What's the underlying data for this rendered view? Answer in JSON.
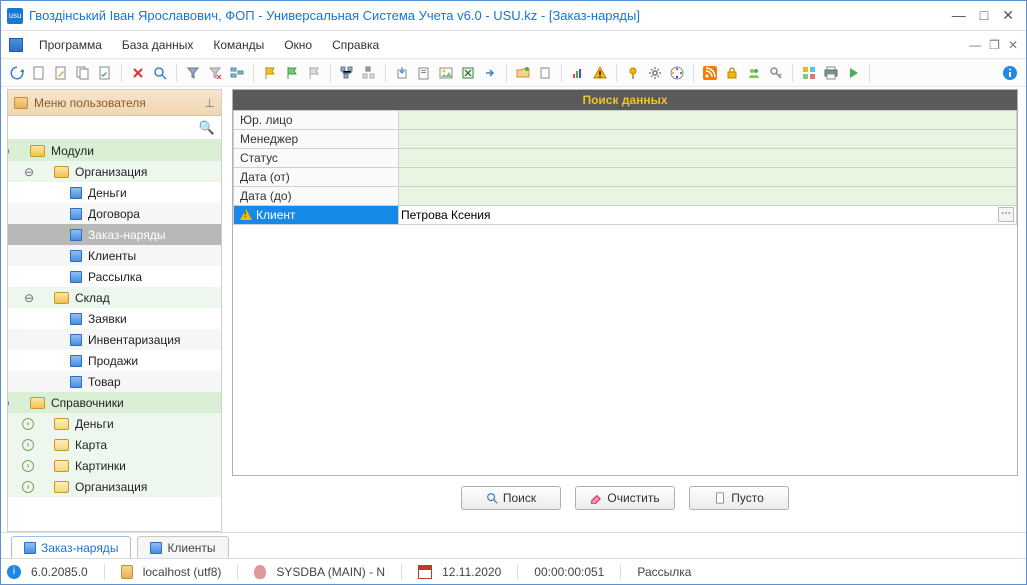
{
  "window": {
    "app_icon_text": "usu",
    "title": "Гвоздінський Іван Ярославович, ФОП - Универсальная Система Учета v6.0 - USU.kz - [Заказ-наряды]"
  },
  "menu": {
    "program": "Программа",
    "database": "База данных",
    "commands": "Команды",
    "window": "Окно",
    "help": "Справка"
  },
  "sidebar": {
    "header": "Меню пользователя",
    "nodes": {
      "modules": "Модули",
      "organization": "Организация",
      "money": "Деньги",
      "contracts": "Договора",
      "orders": "Заказ-наряды",
      "clients": "Клиенты",
      "mailing": "Рассылка",
      "warehouse": "Склад",
      "requests": "Заявки",
      "inventory": "Инвентаризация",
      "sales": "Продажи",
      "goods": "Товар",
      "refs": "Справочники",
      "ref_money": "Деньги",
      "ref_map": "Карта",
      "ref_pictures": "Картинки",
      "ref_org": "Организация"
    }
  },
  "search_panel": {
    "title": "Поиск данных",
    "rows": {
      "entity": "Юр. лицо",
      "manager": "Менеджер",
      "status": "Статус",
      "date_from": "Дата (от)",
      "date_to": "Дата (до)",
      "client": "Клиент"
    },
    "client_value": "Петрова Ксения",
    "buttons": {
      "search": "Поиск",
      "clear": "Очистить",
      "empty": "Пусто"
    }
  },
  "tabs": {
    "orders": "Заказ-наряды",
    "clients": "Клиенты"
  },
  "status": {
    "version": "6.0.2085.0",
    "host": "localhost (utf8)",
    "user": "SYSDBA (MAIN) - N",
    "date": "12.11.2020",
    "time": "00:00:00:051",
    "mailing": "Рассылка"
  }
}
